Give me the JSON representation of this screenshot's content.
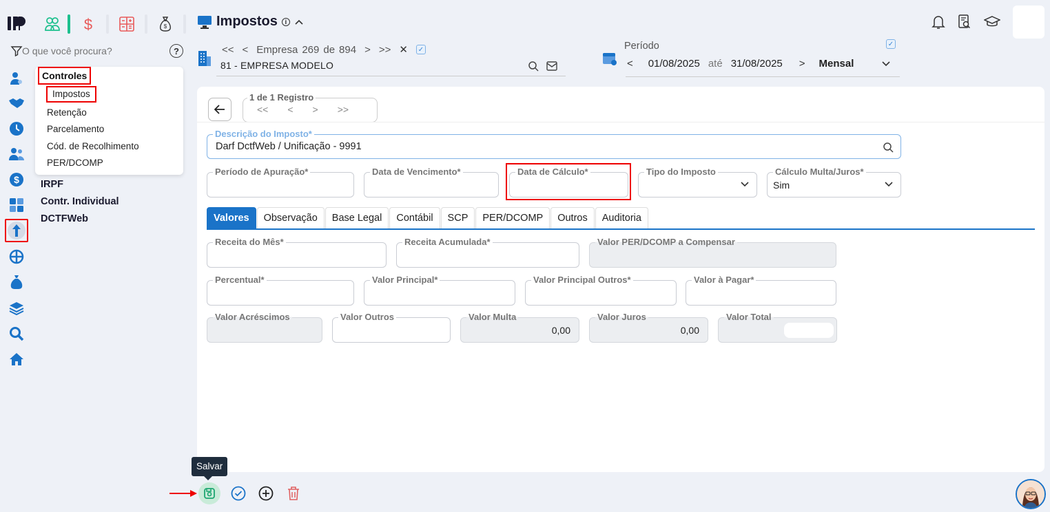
{
  "sidebar_icons": [
    "logo-icon",
    "filter-icon",
    "user-settings-icon",
    "handshake-icon",
    "clock-icon",
    "users-icon",
    "dollar-icon",
    "calculator-icon",
    "tax-upload-icon",
    "globe-network-icon",
    "money-bag-icon",
    "layers-icon",
    "search-icon",
    "home-icon"
  ],
  "search": {
    "placeholder": "O que você procura?",
    "help": "?"
  },
  "menu": {
    "header": "Controles",
    "items": [
      "Impostos",
      "Retenção",
      "Parcelamento",
      "Cód. de Recolhimento",
      "PER/DCOMP"
    ],
    "selected": "Impostos",
    "groups": [
      "IRPF",
      "Contr. Individual",
      "DCTFWeb"
    ]
  },
  "header": {
    "title": "Impostos",
    "info": "i"
  },
  "empresa": {
    "label": "Empresa",
    "index": "269",
    "of": "de",
    "total": "894",
    "name": "81 - EMPRESA MODELO",
    "first": "<<",
    "prev": "<",
    "next": ">",
    "last": ">>",
    "close": "✕"
  },
  "periodo": {
    "label": "Período",
    "start": "01/08/2025",
    "until": "até",
    "end": "31/08/2025",
    "mode": "Mensal"
  },
  "registro": {
    "label": "1 de 1 Registro",
    "first": "<<",
    "prev": "<",
    "next": ">",
    "last": ">>"
  },
  "form": {
    "descricao": {
      "label": "Descrição do Imposto*",
      "value": "Darf DctfWeb / Unificação - 9991"
    },
    "periodo_apuracao": {
      "label": "Período de Apuração*",
      "value": ""
    },
    "data_vencimento": {
      "label": "Data de Vencimento*",
      "value": ""
    },
    "data_calculo": {
      "label": "Data de Cálculo*",
      "value": ""
    },
    "tipo_imposto": {
      "label": "Tipo do Imposto",
      "value": ""
    },
    "calculo_multa": {
      "label": "Cálculo Multa/Juros*",
      "value": "Sim"
    }
  },
  "tabs": [
    "Valores",
    "Observação",
    "Base Legal",
    "Contábil",
    "SCP",
    "PER/DCOMP",
    "Outros",
    "Auditoria"
  ],
  "active_tab": "Valores",
  "valores": {
    "receita_mes": {
      "label": "Receita do Mês*",
      "value": ""
    },
    "receita_acumulada": {
      "label": "Receita Acumulada*",
      "value": ""
    },
    "valor_perdcomp": {
      "label": "Valor PER/DCOMP a Compensar",
      "value": ""
    },
    "percentual": {
      "label": "Percentual*",
      "value": ""
    },
    "valor_principal": {
      "label": "Valor Principal*",
      "value": ""
    },
    "valor_principal_outros": {
      "label": "Valor Principal Outros*",
      "value": ""
    },
    "valor_pagar": {
      "label": "Valor à Pagar*",
      "value": ""
    },
    "valor_acrescimos": {
      "label": "Valor Acréscimos",
      "value": ""
    },
    "valor_outros": {
      "label": "Valor Outros",
      "value": ""
    },
    "valor_multa": {
      "label": "Valor Multa",
      "value": "0,00"
    },
    "valor_juros": {
      "label": "Valor Juros",
      "value": "0,00"
    },
    "valor_total": {
      "label": "Valor Total",
      "value": ""
    }
  },
  "toolbar": {
    "save_tooltip": "Salvar"
  },
  "colors": {
    "primary": "#1a73c8",
    "highlight": "#e00000",
    "save_bg": "#c9ebd9",
    "save_icon": "#1ea672",
    "delete_icon": "#e06060",
    "shortcut_green": "#1ec08e"
  }
}
